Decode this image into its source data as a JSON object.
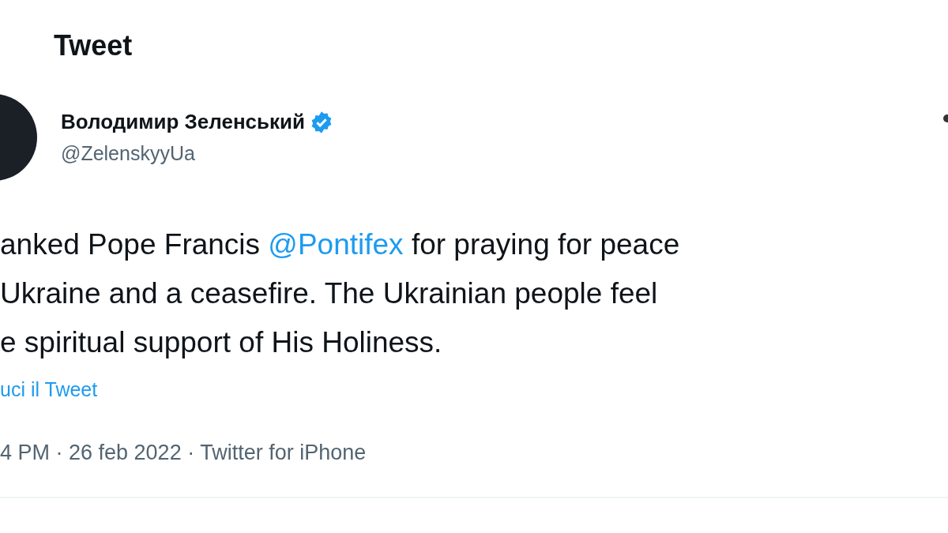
{
  "header": {
    "title": "Tweet"
  },
  "author": {
    "name": "Володимир Зеленський",
    "verified": true,
    "handle": "@ZelenskyyUa"
  },
  "tweet": {
    "lines": [
      [
        {
          "kind": "text",
          "text": "anked Pope Francis "
        },
        {
          "kind": "mention",
          "text": "@Pontifex"
        },
        {
          "kind": "text",
          "text": " for praying for peace"
        }
      ],
      [
        {
          "kind": "text",
          "text": "Ukraine and a ceasefire. The Ukrainian people feel"
        }
      ],
      [
        {
          "kind": "text",
          "text": "e spiritual support of His Holiness."
        }
      ]
    ],
    "translate_link": "uci il Tweet",
    "meta": "4 PM · 26 feb 2022 · Twitter for iPhone"
  }
}
